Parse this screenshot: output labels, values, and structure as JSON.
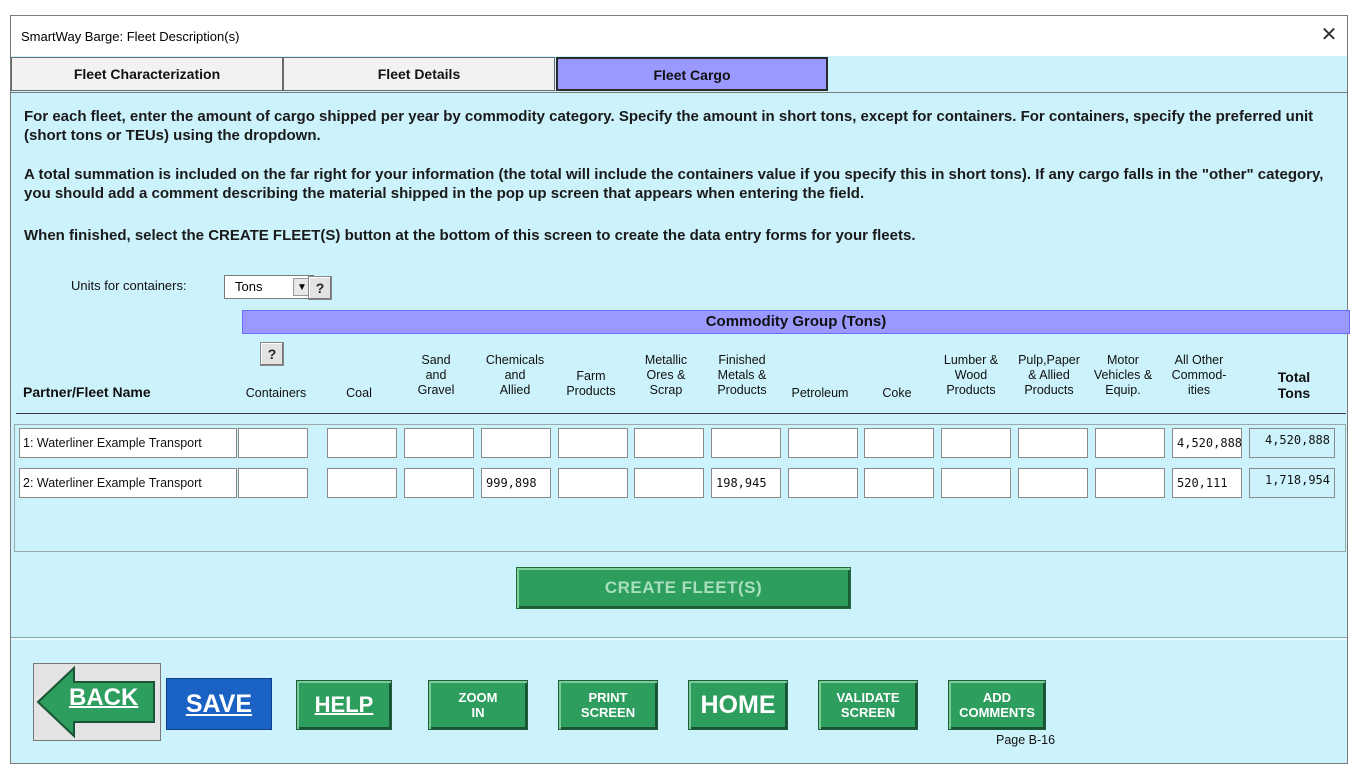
{
  "window": {
    "title": "SmartWay Barge: Fleet Description(s)",
    "close_glyph": "✕"
  },
  "tabs": [
    {
      "label": "Fleet Characterization",
      "active": false
    },
    {
      "label": "Fleet Details",
      "active": false
    },
    {
      "label": "Fleet Cargo",
      "active": true
    }
  ],
  "instructions": {
    "p1": "For each fleet, enter the amount of cargo shipped per year by commodity category. Specify the amount in short tons, except for containers. For containers, specify the preferred unit (short tons or TEUs) using the dropdown.",
    "p2": "A total summation is included on the far right for your information (the total will include the containers value if you specify this in short tons). If any cargo falls in the \"other\" category, you should add a comment describing the material shipped in the pop up screen that appears when entering the field.",
    "p3": "When finished, select the CREATE FLEET(S) button at the bottom of this screen to create the data entry forms for your fleets."
  },
  "units": {
    "label": "Units for containers:",
    "selected": "Tons",
    "help_label": "?"
  },
  "commodity_group_header": "Commodity Group (Tons)",
  "columns": {
    "partner_header": "Partner/Fleet Name",
    "containers_help": "?",
    "commodities": [
      "Containers",
      "Coal",
      "Sand\nand\nGravel",
      "Chemicals\nand\nAllied",
      "Farm\nProducts",
      "Metallic\nOres &\nScrap",
      "Finished\nMetals &\nProducts",
      "Petroleum",
      "Coke",
      "Lumber &\nWood\nProducts",
      "Pulp,Paper\n& Allied\nProducts",
      "Motor\nVehicles &\nEquip.",
      "All Other\nCommod-\nities"
    ],
    "total_header": "Total\nTons"
  },
  "rows": [
    {
      "name": "1: Waterliner Example Transport",
      "values": [
        "",
        "",
        "",
        "",
        "",
        "",
        "",
        "",
        "",
        "",
        "",
        "",
        "4,520,888"
      ],
      "total": "4,520,888"
    },
    {
      "name": "2: Waterliner Example Transport",
      "values": [
        "",
        "",
        "",
        "999,898",
        "",
        "",
        "198,945",
        "",
        "",
        "",
        "",
        "",
        "520,111"
      ],
      "total": "1,718,954"
    }
  ],
  "create_button": "CREATE FLEET(S)",
  "nav": {
    "back": "BACK",
    "save": "SAVE",
    "help": "HELP",
    "zoom_in": "ZOOM\nIN",
    "print_screen": "PRINT\nSCREEN",
    "home": "HOME",
    "validate_screen": "VALIDATE\nSCREEN",
    "add_comments": "ADD\nCOMMENTS"
  },
  "page_number": "Page B-16",
  "colors": {
    "panel_bg": "#ccf2fb",
    "active_tab": "#9999ff",
    "green_button": "#2e9e5f",
    "save_blue": "#1a63c4"
  }
}
